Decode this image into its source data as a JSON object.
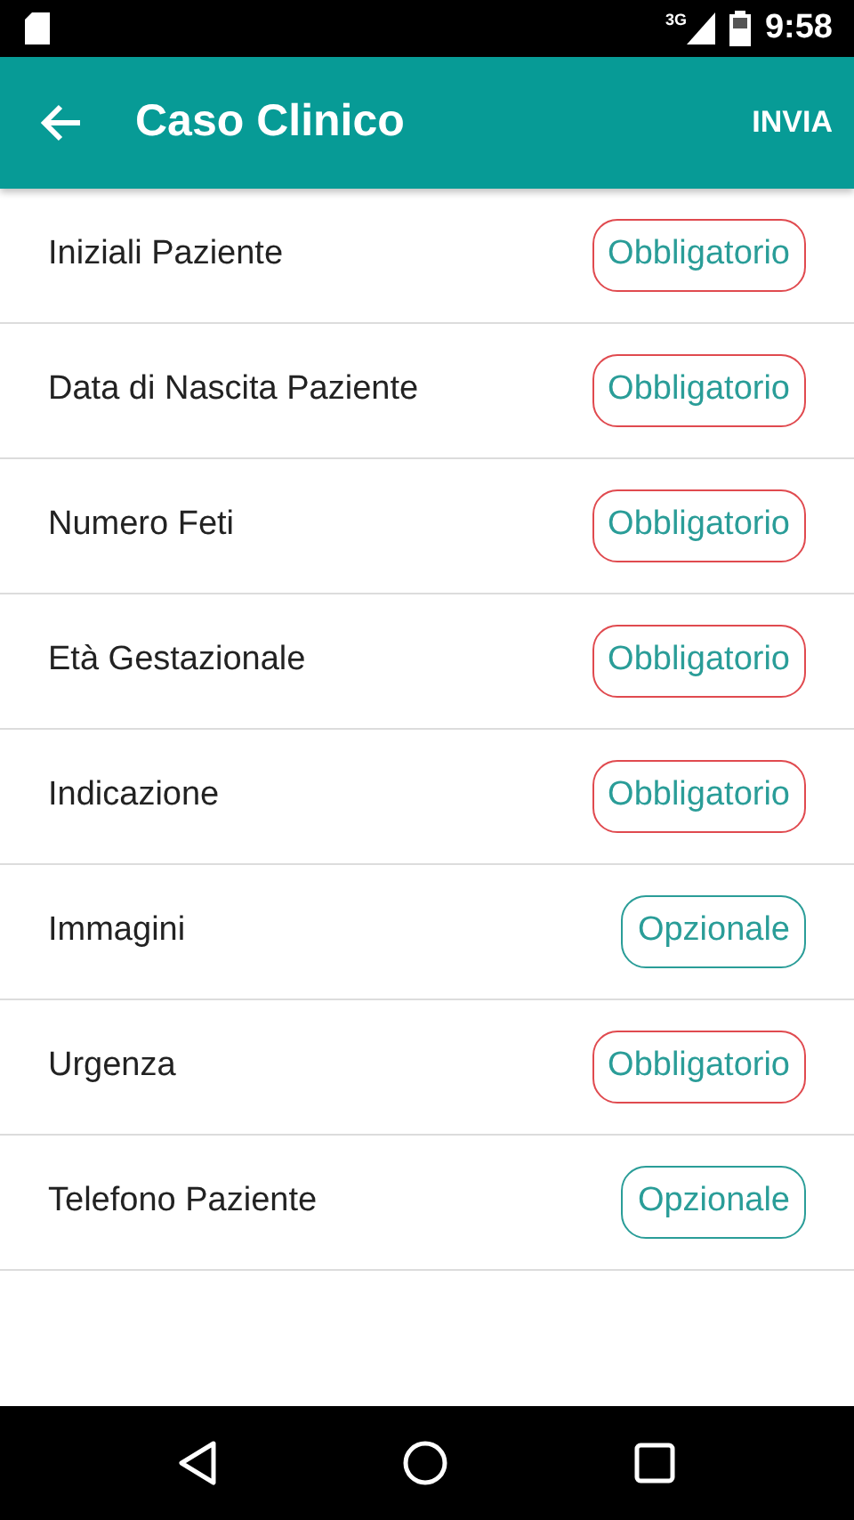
{
  "status_bar": {
    "network": "3G",
    "time": "9:58"
  },
  "app_bar": {
    "title": "Caso Clinico",
    "action": "INVIA"
  },
  "fields": [
    {
      "label": "Iniziali Paziente",
      "badge": "Obbligatorio",
      "kind": "required"
    },
    {
      "label": "Data di Nascita Paziente",
      "badge": "Obbligatorio",
      "kind": "required"
    },
    {
      "label": "Numero Feti",
      "badge": "Obbligatorio",
      "kind": "required"
    },
    {
      "label": "Età Gestazionale",
      "badge": "Obbligatorio",
      "kind": "required"
    },
    {
      "label": "Indicazione",
      "badge": "Obbligatorio",
      "kind": "required"
    },
    {
      "label": "Immagini",
      "badge": "Opzionale",
      "kind": "optional"
    },
    {
      "label": "Urgenza",
      "badge": "Obbligatorio",
      "kind": "required"
    },
    {
      "label": "Telefono Paziente",
      "badge": "Opzionale",
      "kind": "optional"
    }
  ]
}
